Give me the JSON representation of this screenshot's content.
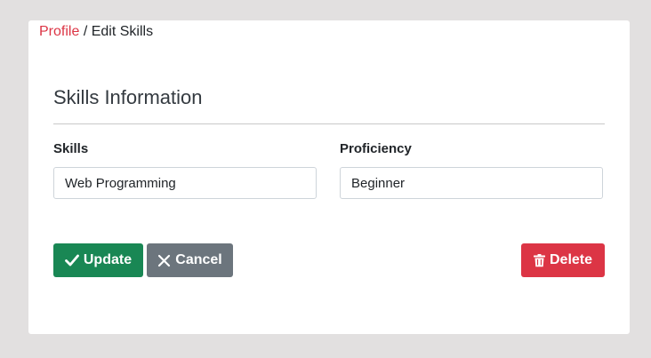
{
  "breadcrumb": {
    "parent": "Profile",
    "separator": "/",
    "current": "Edit Skills"
  },
  "section": {
    "title": "Skills Information"
  },
  "form": {
    "skills_label": "Skills",
    "skills_value": "Web Programming",
    "proficiency_label": "Proficiency",
    "proficiency_value": "Beginner"
  },
  "actions": {
    "update_label": "Update",
    "update_icon": "check-icon",
    "cancel_label": "Cancel",
    "cancel_icon": "close-icon",
    "delete_label": "Delete",
    "delete_icon": "trash-icon"
  },
  "colors": {
    "link": "#dc3545",
    "update": "#198754",
    "cancel": "#6c757d",
    "delete": "#dc3545",
    "background": "#e2e0e0"
  }
}
